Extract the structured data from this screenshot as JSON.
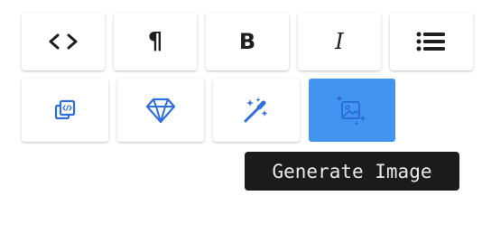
{
  "toolbar": {
    "row1": [
      {
        "name": "code",
        "icon": "code-brackets-icon"
      },
      {
        "name": "paragraph",
        "icon": "pilcrow-icon",
        "glyph": "¶"
      },
      {
        "name": "bold",
        "icon": "bold-icon",
        "glyph": "B"
      },
      {
        "name": "italic",
        "icon": "italic-icon",
        "glyph": "I"
      },
      {
        "name": "list",
        "icon": "bullet-list-icon"
      }
    ],
    "row2": [
      {
        "name": "embed-code",
        "icon": "code-embed-icon"
      },
      {
        "name": "gem",
        "icon": "gem-icon"
      },
      {
        "name": "magic-wand",
        "icon": "magic-wand-icon"
      },
      {
        "name": "generate-image",
        "icon": "image-sparkle-icon",
        "active": true
      }
    ]
  },
  "tooltip": {
    "text": "Generate Image"
  },
  "colors": {
    "accent": "#4394f0",
    "icon_blue": "#2f6fe0",
    "tooltip_bg": "#1b1b1b"
  }
}
